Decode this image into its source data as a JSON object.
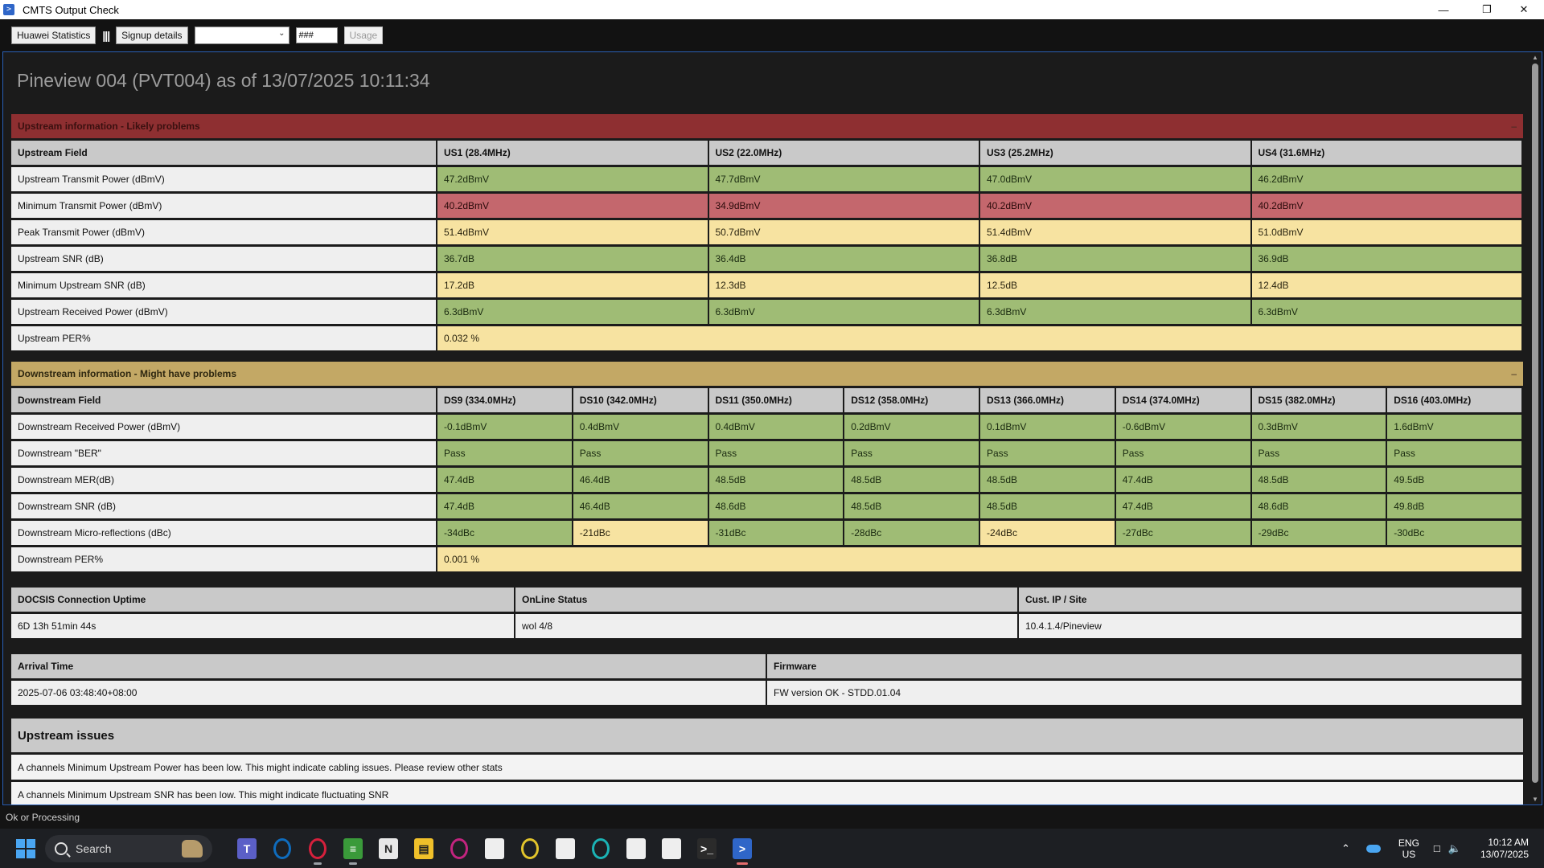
{
  "window": {
    "title": "CMTS Output Check",
    "app_icon": "powershell-icon",
    "controls": [
      "minimize",
      "maximize",
      "close"
    ]
  },
  "toolbar": {
    "huawei_label": "Huawei Statistics",
    "separator": "|||",
    "signup_label": "Signup details",
    "dropdown_value": "",
    "node_input": "###",
    "usage_label": "Usage"
  },
  "page": {
    "title": "Pineview 004 (PVT004) as of 13/07/2025 10:11:34"
  },
  "upstream": {
    "header": "Upstream information - Likely problems",
    "collapse": "–",
    "field_header": "Upstream Field",
    "columns": [
      "US1 (28.4MHz)",
      "US2 (22.0MHz)",
      "US3 (25.2MHz)",
      "US4 (31.6MHz)"
    ],
    "rows": [
      {
        "field": "Upstream Transmit Power (dBmV)",
        "values": [
          "47.2dBmV",
          "47.7dBmV",
          "47.0dBmV",
          "46.2dBmV"
        ],
        "status": [
          "g",
          "g",
          "g",
          "g"
        ]
      },
      {
        "field": "Minimum Transmit Power (dBmV)",
        "values": [
          "40.2dBmV",
          "34.9dBmV",
          "40.2dBmV",
          "40.2dBmV"
        ],
        "status": [
          "r",
          "r",
          "r",
          "r"
        ]
      },
      {
        "field": "Peak Transmit Power (dBmV)",
        "values": [
          "51.4dBmV",
          "50.7dBmV",
          "51.4dBmV",
          "51.0dBmV"
        ],
        "status": [
          "y",
          "y",
          "y",
          "y"
        ]
      },
      {
        "field": "Upstream SNR (dB)",
        "values": [
          "36.7dB",
          "36.4dB",
          "36.8dB",
          "36.9dB"
        ],
        "status": [
          "g",
          "g",
          "g",
          "g"
        ]
      },
      {
        "field": "Minimum Upstream SNR (dB)",
        "values": [
          "17.2dB",
          "12.3dB",
          "12.5dB",
          "12.4dB"
        ],
        "status": [
          "y",
          "y",
          "y",
          "y"
        ]
      },
      {
        "field": "Upstream Received Power (dBmV)",
        "values": [
          "6.3dBmV",
          "6.3dBmV",
          "6.3dBmV",
          "6.3dBmV"
        ],
        "status": [
          "g",
          "g",
          "g",
          "g"
        ]
      }
    ],
    "per_field": "Upstream PER%",
    "per_value": "0.032 %"
  },
  "downstream": {
    "header": "Downstream information - Might have problems",
    "collapse": "–",
    "field_header": "Downstream Field",
    "columns": [
      "DS9 (334.0MHz)",
      "DS10 (342.0MHz)",
      "DS11 (350.0MHz)",
      "DS12 (358.0MHz)",
      "DS13 (366.0MHz)",
      "DS14 (374.0MHz)",
      "DS15 (382.0MHz)",
      "DS16 (403.0MHz)"
    ],
    "rows": [
      {
        "field": "Downstream Received Power (dBmV)",
        "values": [
          "-0.1dBmV",
          "0.4dBmV",
          "0.4dBmV",
          "0.2dBmV",
          "0.1dBmV",
          "-0.6dBmV",
          "0.3dBmV",
          "1.6dBmV"
        ],
        "status": [
          "g",
          "g",
          "g",
          "g",
          "g",
          "g",
          "g",
          "g"
        ]
      },
      {
        "field": "Downstream \"BER\"",
        "values": [
          "Pass",
          "Pass",
          "Pass",
          "Pass",
          "Pass",
          "Pass",
          "Pass",
          "Pass"
        ],
        "status": [
          "g",
          "g",
          "g",
          "g",
          "g",
          "g",
          "g",
          "g"
        ]
      },
      {
        "field": "Downstream MER(dB)",
        "values": [
          "47.4dB",
          "46.4dB",
          "48.5dB",
          "48.5dB",
          "48.5dB",
          "47.4dB",
          "48.5dB",
          "49.5dB"
        ],
        "status": [
          "g",
          "g",
          "g",
          "g",
          "g",
          "g",
          "g",
          "g"
        ]
      },
      {
        "field": "Downstream SNR (dB)",
        "values": [
          "47.4dB",
          "46.4dB",
          "48.6dB",
          "48.5dB",
          "48.5dB",
          "47.4dB",
          "48.6dB",
          "49.8dB"
        ],
        "status": [
          "g",
          "g",
          "g",
          "g",
          "g",
          "g",
          "g",
          "g"
        ]
      },
      {
        "field": "Downstream Micro-reflections (dBc)",
        "values": [
          "-34dBc",
          "-21dBc",
          "-31dBc",
          "-28dBc",
          "-24dBc",
          "-27dBc",
          "-29dBc",
          "-30dBc"
        ],
        "status": [
          "g",
          "y",
          "g",
          "g",
          "y",
          "g",
          "g",
          "g"
        ]
      }
    ],
    "per_field": "Downstream PER%",
    "per_value": "0.001 %"
  },
  "connection": {
    "headers": [
      "DOCSIS Connection Uptime",
      "OnLine Status",
      "Cust. IP / Site"
    ],
    "values": [
      "6D 13h 51min 44s",
      "wol 4/8",
      "10.4.1.4/Pineview"
    ]
  },
  "arrival": {
    "headers": [
      "Arrival Time",
      "Firmware"
    ],
    "values": [
      "2025-07-06 03:48:40+08:00",
      "FW version OK - STDD.01.04"
    ]
  },
  "issues": {
    "header": "Upstream issues",
    "items": [
      "A channels Minimum Upstream Power has been low. This might indicate cabling issues. Please review other stats",
      "A channels Minimum Upstream SNR has been low. This might indicate fluctuating SNR"
    ]
  },
  "status": {
    "text": "Ok or Processing"
  },
  "taskbar": {
    "search_placeholder": "Search",
    "apps": [
      {
        "name": "teams-icon",
        "color": "#5b5fc7",
        "glyph": "T"
      },
      {
        "name": "outlook-icon",
        "color": "#0f6cbd",
        "glyph": "O"
      },
      {
        "name": "opera-icon",
        "color": "#d6203c",
        "glyph": "O"
      },
      {
        "name": "notepad-green-icon",
        "color": "#3a9a3a",
        "glyph": "≡"
      },
      {
        "name": "app-n-icon",
        "color": "#e8e8e8",
        "glyph": "N"
      },
      {
        "name": "file-explorer-icon",
        "color": "#f0c02a",
        "glyph": "▤"
      },
      {
        "name": "opera-gx-icon",
        "color": "#c3247f",
        "glyph": "O"
      },
      {
        "name": "file-icon",
        "color": "#eeeeee",
        "glyph": ""
      },
      {
        "name": "opera-yellow-icon",
        "color": "#e2c42c",
        "glyph": "O"
      },
      {
        "name": "file-icon",
        "color": "#eeeeee",
        "glyph": ""
      },
      {
        "name": "opera-teal-icon",
        "color": "#1bb3b5",
        "glyph": "O"
      },
      {
        "name": "file-icon",
        "color": "#eeeeee",
        "glyph": ""
      },
      {
        "name": "file-icon",
        "color": "#eeeeee",
        "glyph": ""
      },
      {
        "name": "terminal-icon",
        "color": "#2b2b2b",
        "glyph": ">_"
      },
      {
        "name": "powershell-icon",
        "color": "#2f66c8",
        "glyph": ">"
      }
    ],
    "lang": "ENG",
    "region": "US",
    "time": "10:12 AM",
    "date": "13/07/2025"
  }
}
